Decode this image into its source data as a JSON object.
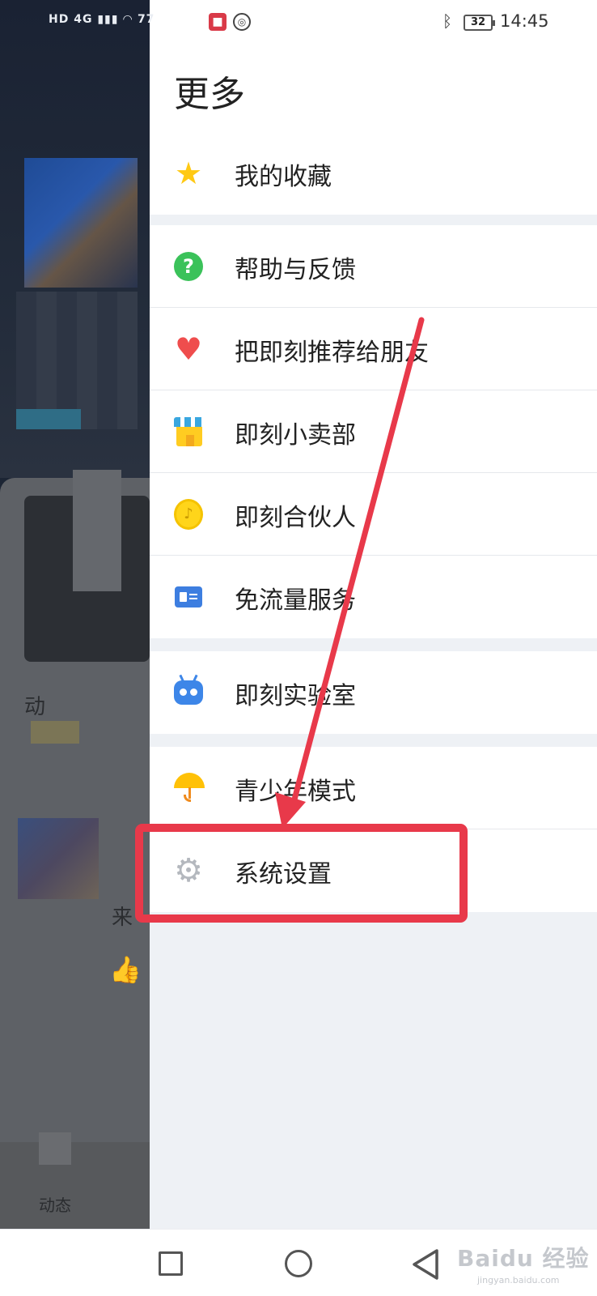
{
  "status_bar": {
    "left_indicators": "HD 4G ▮▮▮ ◠ 77",
    "app1_glyph": "■",
    "app2_glyph": "◎",
    "bluetooth_glyph": "ᛒ",
    "battery": "32",
    "time": "14:45"
  },
  "background": {
    "partial_text_1": "动",
    "partial_text_2": "来",
    "tab_label": "动态"
  },
  "drawer": {
    "title": "更多",
    "group1": [
      {
        "label": "我的收藏",
        "icon": "star-icon"
      }
    ],
    "group2": [
      {
        "label": "帮助与反馈",
        "icon": "help-icon"
      },
      {
        "label": "把即刻推荐给朋友",
        "icon": "heart-icon"
      },
      {
        "label": "即刻小卖部",
        "icon": "store-icon"
      },
      {
        "label": "即刻合伙人",
        "icon": "coin-icon"
      },
      {
        "label": "免流量服务",
        "icon": "card-icon"
      }
    ],
    "group3": [
      {
        "label": "即刻实验室",
        "icon": "robot-icon"
      }
    ],
    "group4": [
      {
        "label": "青少年模式",
        "icon": "umbrella-icon"
      },
      {
        "label": "系统设置",
        "icon": "gear-icon"
      }
    ]
  },
  "icons": {
    "star": "★",
    "help": "?",
    "heart": "♥",
    "coin": "♪",
    "gear": "⚙"
  },
  "annotation": {
    "color": "#e8394a"
  },
  "watermark": {
    "main": "Baidu 经验",
    "sub": "jingyan.baidu.com"
  }
}
